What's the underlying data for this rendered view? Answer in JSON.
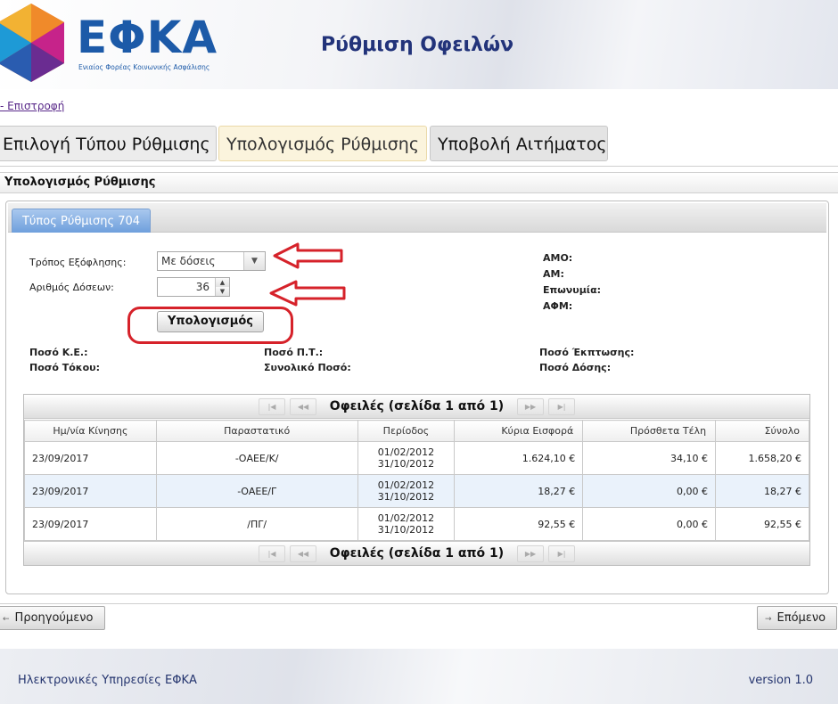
{
  "header": {
    "logo_text": "ΕΦΚΑ",
    "logo_subtitle": "Ενιαίος Φορέας Κοινωνικής Ασφάλισης",
    "app_title": "Ρύθμιση Οφειλών"
  },
  "back_link": "- Επιστροφή",
  "wizard_tabs": [
    {
      "label": "Επιλογή Τύπου Ρύθμισης"
    },
    {
      "label": "Υπολογισμός Ρύθμισης"
    },
    {
      "label": "Υποβολή Αιτήματος"
    }
  ],
  "section_title": "Υπολογισμός Ρύθμισης",
  "type_tab": "Τύπος Ρύθμισης 704",
  "form": {
    "payment_method_label": "Τρόπος Εξόφλησης:",
    "payment_method_value": "Με δόσεις",
    "installments_label": "Αριθμός Δόσεων:",
    "installments_value": "36",
    "calc_button": "Υπολογισμός"
  },
  "insured": {
    "amo": "ΑΜΟ:",
    "am": "ΑΜ:",
    "name": "Επωνυμία:",
    "afm": "ΑΦΜ:"
  },
  "summary": {
    "ke": "Ποσό Κ.Ε.:",
    "interest": "Ποσό Τόκου:",
    "pt": "Ποσό Π.Τ.:",
    "total": "Συνολικό Ποσό:",
    "discount": "Ποσό Έκπτωσης:",
    "installment": "Ποσό Δόσης:"
  },
  "grid": {
    "pager_title": "Οφειλές (σελίδα 1 από 1)",
    "pager_icons": [
      "first-page-icon",
      "prev-page-icon",
      "next-page-icon",
      "last-page-icon"
    ],
    "columns": [
      "Ημ/νία Κίνησης",
      "Παραστατικό",
      "Περίοδος",
      "Κύρια Εισφορά",
      "Πρόσθετα Τέλη",
      "Σύνολο"
    ],
    "rows": [
      {
        "date": "23/09/2017",
        "doc": "-ΟΑΕΕ/Κ/",
        "period_from": "01/02/2012",
        "period_to": "31/10/2012",
        "main": "1.624,10 €",
        "extra": "34,10 €",
        "total": "1.658,20 €"
      },
      {
        "date": "23/09/2017",
        "doc": "-ΟΑΕΕ/Γ",
        "period_from": "01/02/2012",
        "period_to": "31/10/2012",
        "main": "18,27 €",
        "extra": "0,00 €",
        "total": "18,27 €"
      },
      {
        "date": "23/09/2017",
        "doc": "/ΠΓ/",
        "period_from": "01/02/2012",
        "period_to": "31/10/2012",
        "main": "92,55 €",
        "extra": "0,00 €",
        "total": "92,55 €"
      }
    ]
  },
  "nav": {
    "prev": "Προηγούμενο",
    "next": "Επόμενο"
  },
  "footer": {
    "text": "Ηλεκτρονικές Υπηρεσίες ΕΦΚΑ",
    "version": "version 1.0"
  },
  "colors": {
    "brand_blue": "#1c5aa8",
    "title_navy": "#22337a",
    "annotation_red": "#d6222a",
    "active_tab_blue": "#6e9fdc"
  }
}
